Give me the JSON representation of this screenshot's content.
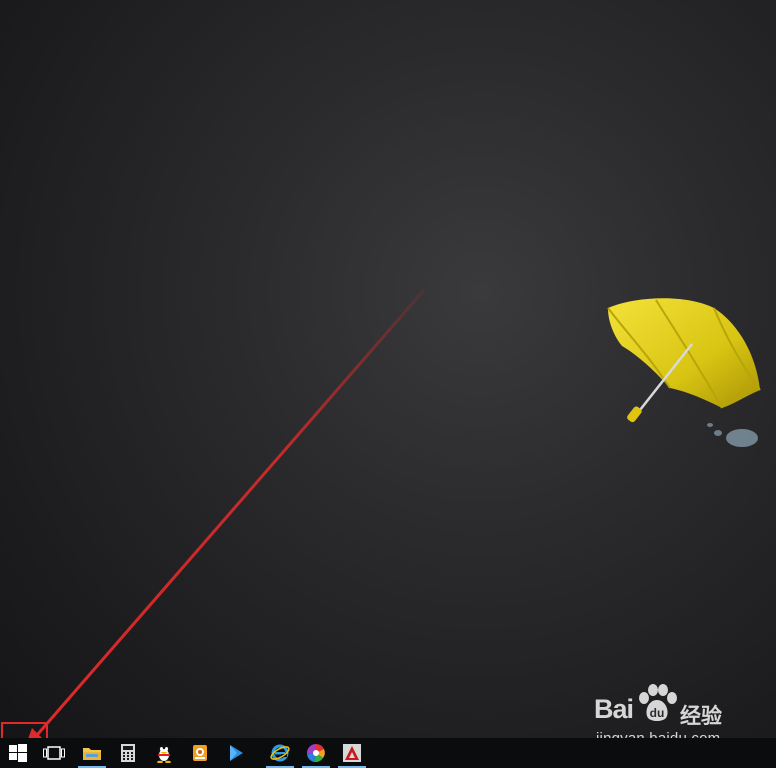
{
  "desktop": {
    "wallpaper": "black-gradient-with-yellow-umbrella",
    "background_color": "#222224"
  },
  "annotation": {
    "arrow_color": "#e02a2a",
    "highlight_target": "start-button"
  },
  "watermark": {
    "brand": "Bai",
    "brand_suffix": "经验",
    "url": "jingyan.baidu.com"
  },
  "taskbar": {
    "background": "#0b0c0e",
    "accent": "#76b9ed",
    "items": [
      {
        "icon": "windows-logo-icon",
        "running": false
      },
      {
        "icon": "task-view-icon",
        "running": false
      },
      {
        "icon": "file-explorer-icon",
        "running": true
      },
      {
        "icon": "calculator-icon",
        "running": false
      },
      {
        "icon": "qq-penguin-icon",
        "running": false
      },
      {
        "icon": "media-app-icon",
        "running": false
      },
      {
        "icon": "media-player-icon",
        "running": false
      },
      {
        "icon": "internet-explorer-icon",
        "running": true
      },
      {
        "icon": "color-wheel-icon",
        "running": true
      },
      {
        "icon": "autocad-icon",
        "running": true
      }
    ]
  }
}
